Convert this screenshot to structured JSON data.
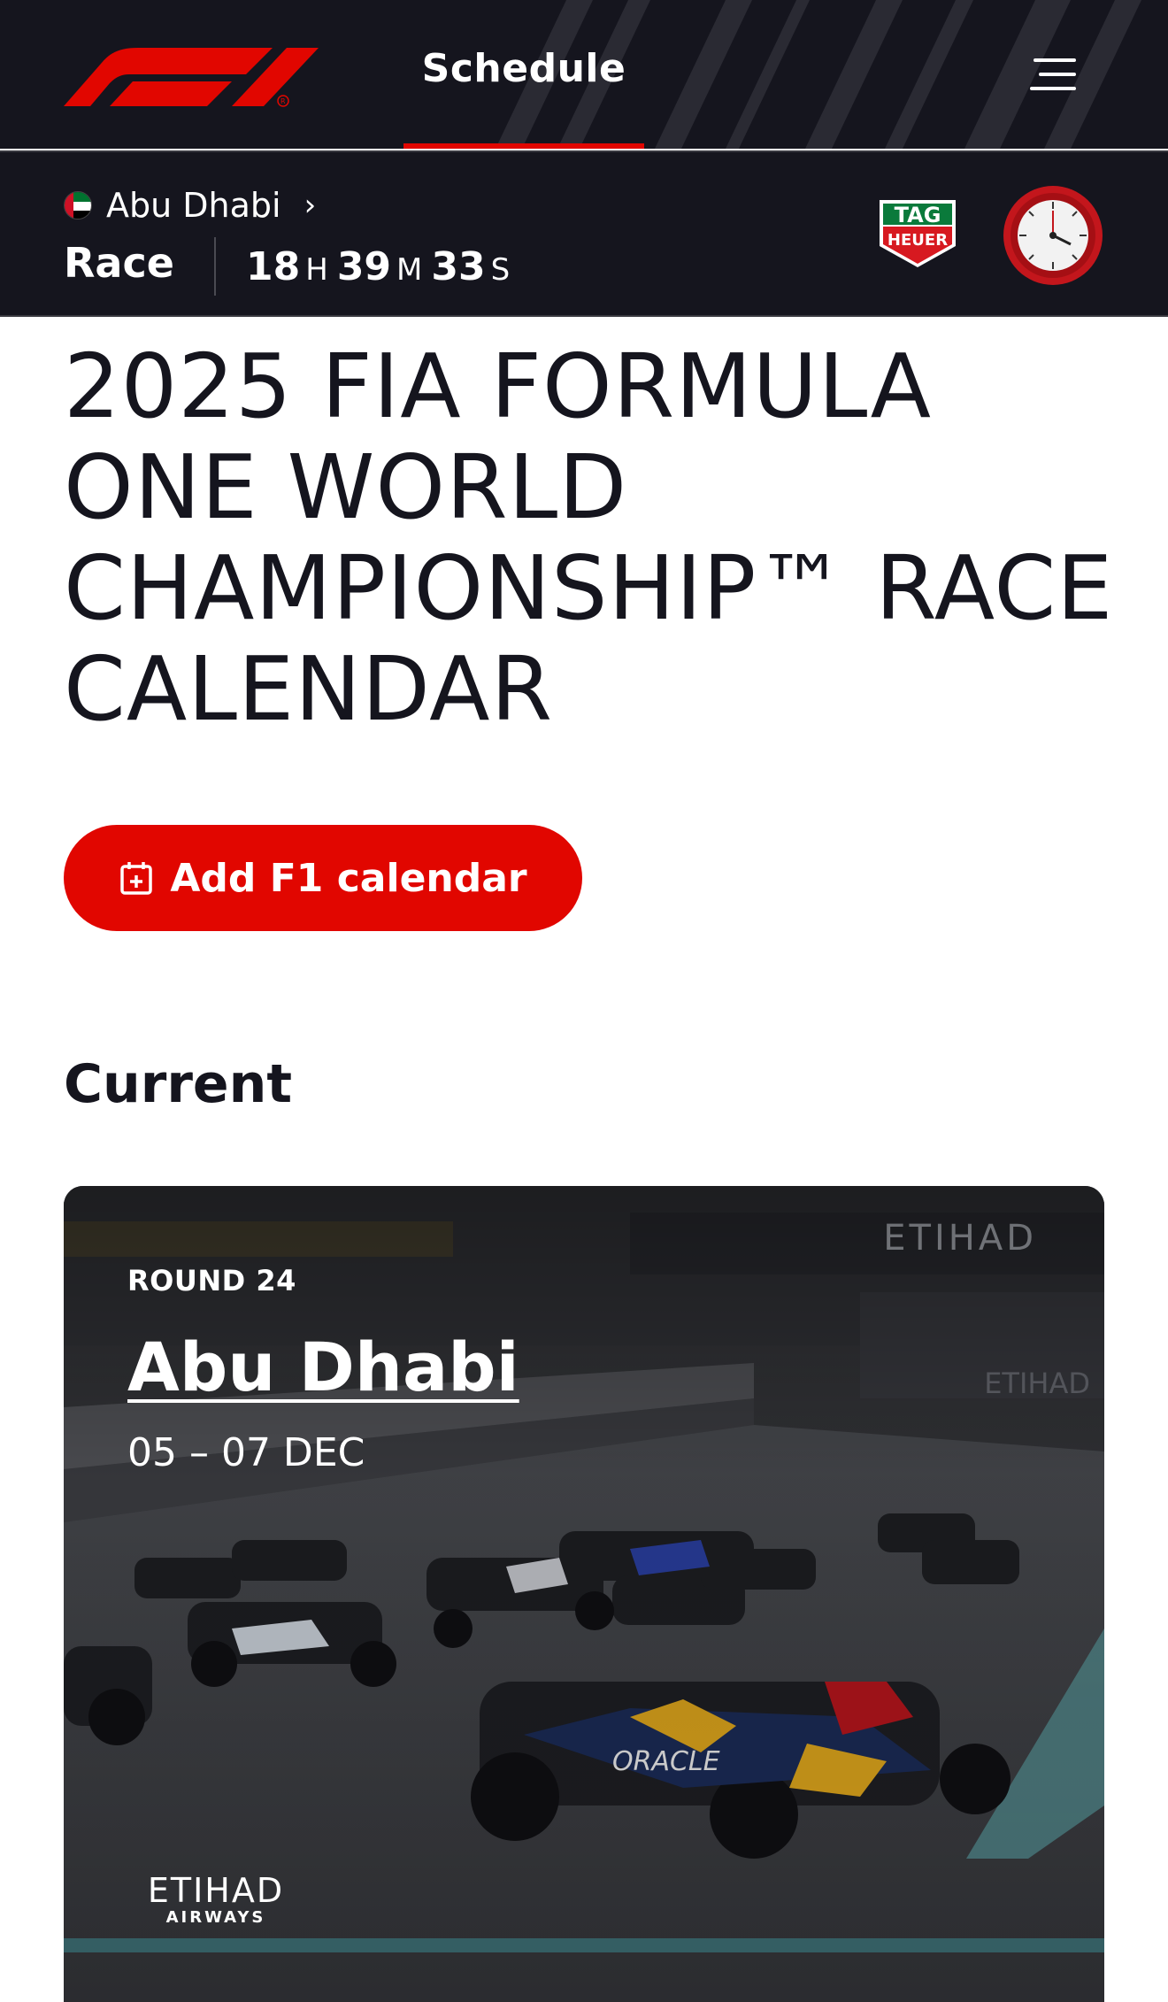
{
  "header": {
    "logo": "f1-logo",
    "nav_tab_label": "Schedule",
    "menu_icon": "hamburger-menu-icon",
    "accent_color": "#e10600",
    "background_color": "#15151e"
  },
  "race_bar": {
    "country": "Abu Dhabi",
    "session": "Race",
    "countdown": {
      "hours": "18",
      "hours_unit": "H",
      "minutes": "39",
      "minutes_unit": "M",
      "seconds": "33",
      "seconds_unit": "S"
    },
    "sponsor_logo_text": "TAG HEUER",
    "watch_icon": "stopwatch-icon"
  },
  "page": {
    "title": "2025 FIA FORMULA ONE WORLD CHAMPIONSHIP™ RACE CALENDAR",
    "add_calendar_label": "Add F1 calendar",
    "section_current": "Current"
  },
  "current_event": {
    "round": "ROUND 24",
    "name": "Abu Dhabi",
    "dates": "05 – 07 DEC",
    "sponsor_name": "ETIHAD",
    "sponsor_sub": "AIRWAYS",
    "image": "race-start-photo"
  }
}
